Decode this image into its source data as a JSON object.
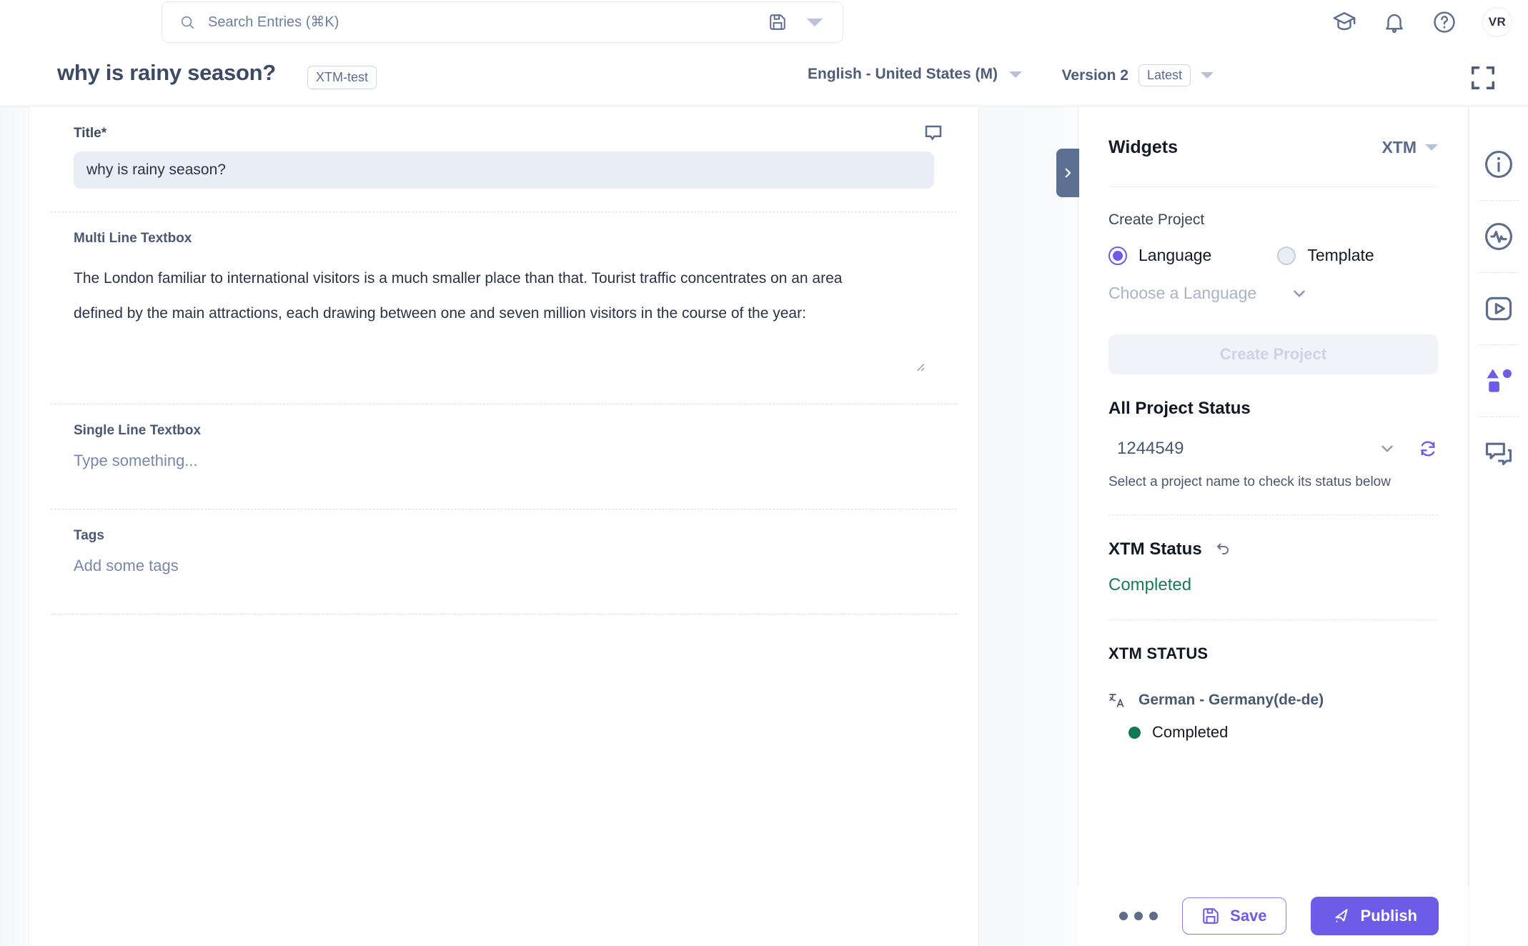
{
  "topbar": {
    "search": {
      "placeholder": "Search Entries (⌘K)",
      "value": "",
      "icon": "search-icon"
    },
    "save_view_icon": "floppy-disk-icon",
    "caret_icon": "caret-down-icon",
    "icons": [
      {
        "name": "graduation-cap-icon",
        "label": "Learning"
      },
      {
        "name": "bell-icon",
        "label": "Notifications"
      },
      {
        "name": "help-circle-icon",
        "label": "Help"
      }
    ],
    "avatar_initials": "VR"
  },
  "titlebar": {
    "entry_title": "why is rainy season?",
    "entry_badge": "XTM-test",
    "language": "English - United States (M)",
    "version_label": "Version 2",
    "version_pill": "Latest",
    "expand_icon": "fullscreen-icon"
  },
  "form": {
    "fields": [
      {
        "label": "Title*",
        "type": "title",
        "value": "why is rainy season?",
        "comment_icon": "comment-bubble-icon"
      },
      {
        "label": "Multi Line Textbox",
        "type": "multiline",
        "line1": "The London familiar to international visitors is a much smaller place than that. Tourist traffic concentrates on an area",
        "line2": "defined by the main attractions, each drawing between one and seven million visitors in the course of the year:"
      },
      {
        "label": "Single Line Textbox",
        "type": "singleline",
        "placeholder": "Type something..."
      },
      {
        "label": "Tags",
        "type": "tags",
        "placeholder": "Add some tags"
      }
    ]
  },
  "widgets": {
    "panel_title": "Widgets",
    "source_label": "XTM",
    "collapse_icon": "chevron-right-icon",
    "create_project": {
      "section_label": "Create Project",
      "radio_language": "Language",
      "radio_template": "Template",
      "selected": "Language",
      "dropdown_placeholder": "Choose a Language",
      "button_label": "Create Project",
      "button_disabled": true
    },
    "all_project_status": {
      "heading": "All Project Status",
      "project_id": "1244549",
      "hint": "Select a project name to check its status below",
      "refresh_icon": "refresh-icon",
      "chevron_icon": "chevron-down-icon"
    },
    "xtm_status": {
      "heading": "XTM Status",
      "undo_icon": "undo-arrow-icon",
      "value": "Completed",
      "value_color": "#1a7a55"
    },
    "xtm_status_list": {
      "heading": "XTM STATUS",
      "items": [
        {
          "language": "German - Germany(de-de)",
          "icon": "translate-icon",
          "status": "Completed",
          "status_color": "#0f7a52"
        }
      ]
    }
  },
  "actions": {
    "more_label": "More options",
    "save_label": "Save",
    "save_icon": "floppy-disk-icon",
    "publish_label": "Publish",
    "publish_icon": "rocket-icon"
  },
  "rail": {
    "items": [
      {
        "name": "info-icon",
        "active": false
      },
      {
        "name": "activity-pulse-icon",
        "active": false
      },
      {
        "name": "play-video-icon",
        "active": false
      },
      {
        "name": "widgets-shapes-icon",
        "active": true
      },
      {
        "name": "chat-bubbles-icon",
        "active": false
      }
    ]
  },
  "colors": {
    "accent": "#6c5ce7",
    "success": "#0f7a52",
    "text_dark": "#3e4a63",
    "muted": "#7a87a6"
  }
}
